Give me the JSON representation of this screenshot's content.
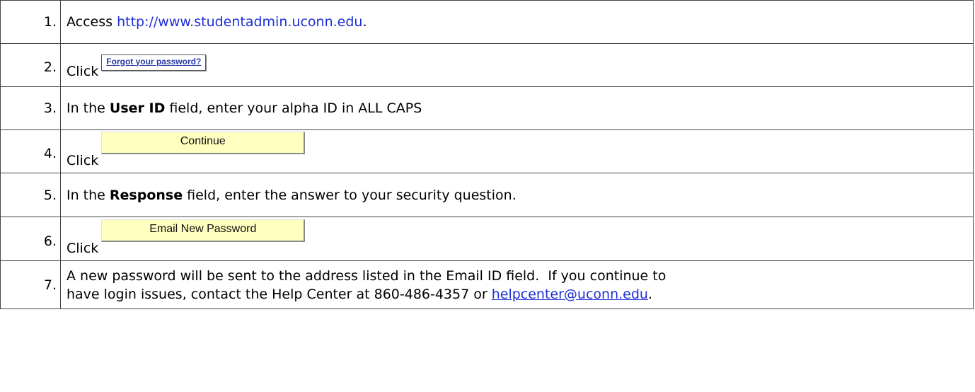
{
  "steps": [
    {
      "num": "1.",
      "prefix": "Access ",
      "link": "http://www.studentadmin.uconn.edu",
      "suffix": "."
    },
    {
      "num": "2.",
      "click": "Click",
      "button": "Forgot your password?"
    },
    {
      "num": "3.",
      "pre": "In the ",
      "bold": "User ID",
      "post": " field, enter your alpha ID in ALL CAPS"
    },
    {
      "num": "4.",
      "click": "Click",
      "button": "Continue"
    },
    {
      "num": "5.",
      "pre": "In the ",
      "bold": "Response",
      "post": " field, enter the answer to your security question."
    },
    {
      "num": "6.",
      "click": "Click",
      "button": "Email New Password"
    },
    {
      "num": "7.",
      "line1": "A new password will be sent to the address listed in the Email ID field.  If you continue to",
      "line2_pre": "have login issues, contact the Help Center at 860-486-4357 or ",
      "email": "helpcenter@uconn.edu",
      "line2_post": "."
    }
  ]
}
